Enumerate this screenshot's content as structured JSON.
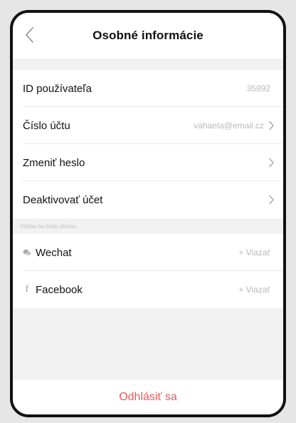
{
  "header": {
    "title": "Osobné informácie"
  },
  "account": {
    "user_id_label": "ID používateľa",
    "user_id_value": "35892",
    "account_number_label": "Číslo účtu",
    "account_number_value": "vahaeta@email.cz",
    "change_password_label": "Zmeniť heslo",
    "deactivate_label": "Deaktivovať účet"
  },
  "third_party": {
    "header": "Väzba na tretiu stranu",
    "wechat_label": "Wechat",
    "wechat_action": "+ Viazať",
    "facebook_label": "Facebook",
    "facebook_action": "+ Viazať"
  },
  "footer": {
    "logout_label": "Odhlásiť sa"
  },
  "colors": {
    "accent_red": "#ee5a5a",
    "muted_text": "#b9b9b9"
  },
  "icons": {
    "back": "chevron-left-icon",
    "chevron": "chevron-right-icon",
    "wechat": "wechat-icon",
    "facebook": "facebook-icon"
  }
}
